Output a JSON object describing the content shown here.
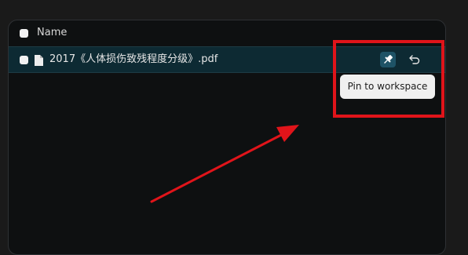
{
  "table": {
    "header": {
      "name_label": "Name"
    },
    "rows": [
      {
        "file_name": "2017《人体损伤致残程度分级》.pdf",
        "icon": "document-icon"
      }
    ]
  },
  "actions": {
    "pin_icon": "pin-icon",
    "undo_icon": "undo-icon"
  },
  "tooltip": {
    "text": "Pin to workspace"
  },
  "annotation": {
    "color": "#e0141a"
  }
}
